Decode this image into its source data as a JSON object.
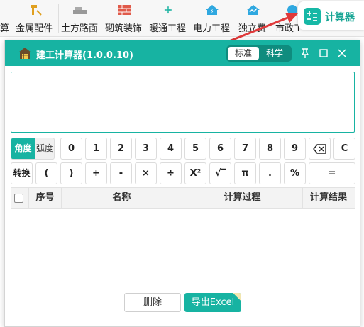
{
  "ribbon": {
    "items": [
      {
        "label": "算",
        "icon": "partial-icon"
      },
      {
        "label": "金属配件",
        "icon": "hammer-icon"
      },
      {
        "label": "土方路面",
        "icon": "road-roller-icon"
      },
      {
        "label": "砌筑装饰",
        "icon": "brick-wall-icon"
      },
      {
        "label": "暖通工程",
        "icon": "fan-icon"
      },
      {
        "label": "电力工程",
        "icon": "power-house-icon"
      },
      {
        "label": "独立费",
        "icon": "chart-house-icon"
      },
      {
        "label": "市政工",
        "icon": "road-icon"
      }
    ],
    "calc_tab": {
      "label": "计算器",
      "icon": "calculator-icon"
    }
  },
  "window": {
    "title": "建工计算器(1.0.0.10)",
    "modes": {
      "standard": "标准",
      "scientific": "科学",
      "active": "standard"
    },
    "controls": {
      "pin": "pin-icon",
      "maximize": "maximize-icon",
      "close": "close-icon"
    },
    "display_value": ""
  },
  "keypad": {
    "angle": {
      "deg": "角度",
      "rad": "弧度",
      "active": "deg"
    },
    "row1": [
      "0",
      "1",
      "2",
      "3",
      "4",
      "5",
      "6",
      "7",
      "8",
      "9",
      "⌫",
      "C"
    ],
    "row2": [
      "转换",
      "(",
      ")",
      "+",
      "-",
      "×",
      "÷",
      "X²",
      "√‾",
      "π",
      ".",
      "%",
      "="
    ]
  },
  "table": {
    "headers": [
      "序号",
      "名称",
      "计算过程",
      "计算结果"
    ],
    "rows": []
  },
  "footer": {
    "delete_label": "删除",
    "export_label": "导出Excel"
  },
  "colors": {
    "accent": "#17b3a2",
    "arrow": "#e0393a"
  }
}
